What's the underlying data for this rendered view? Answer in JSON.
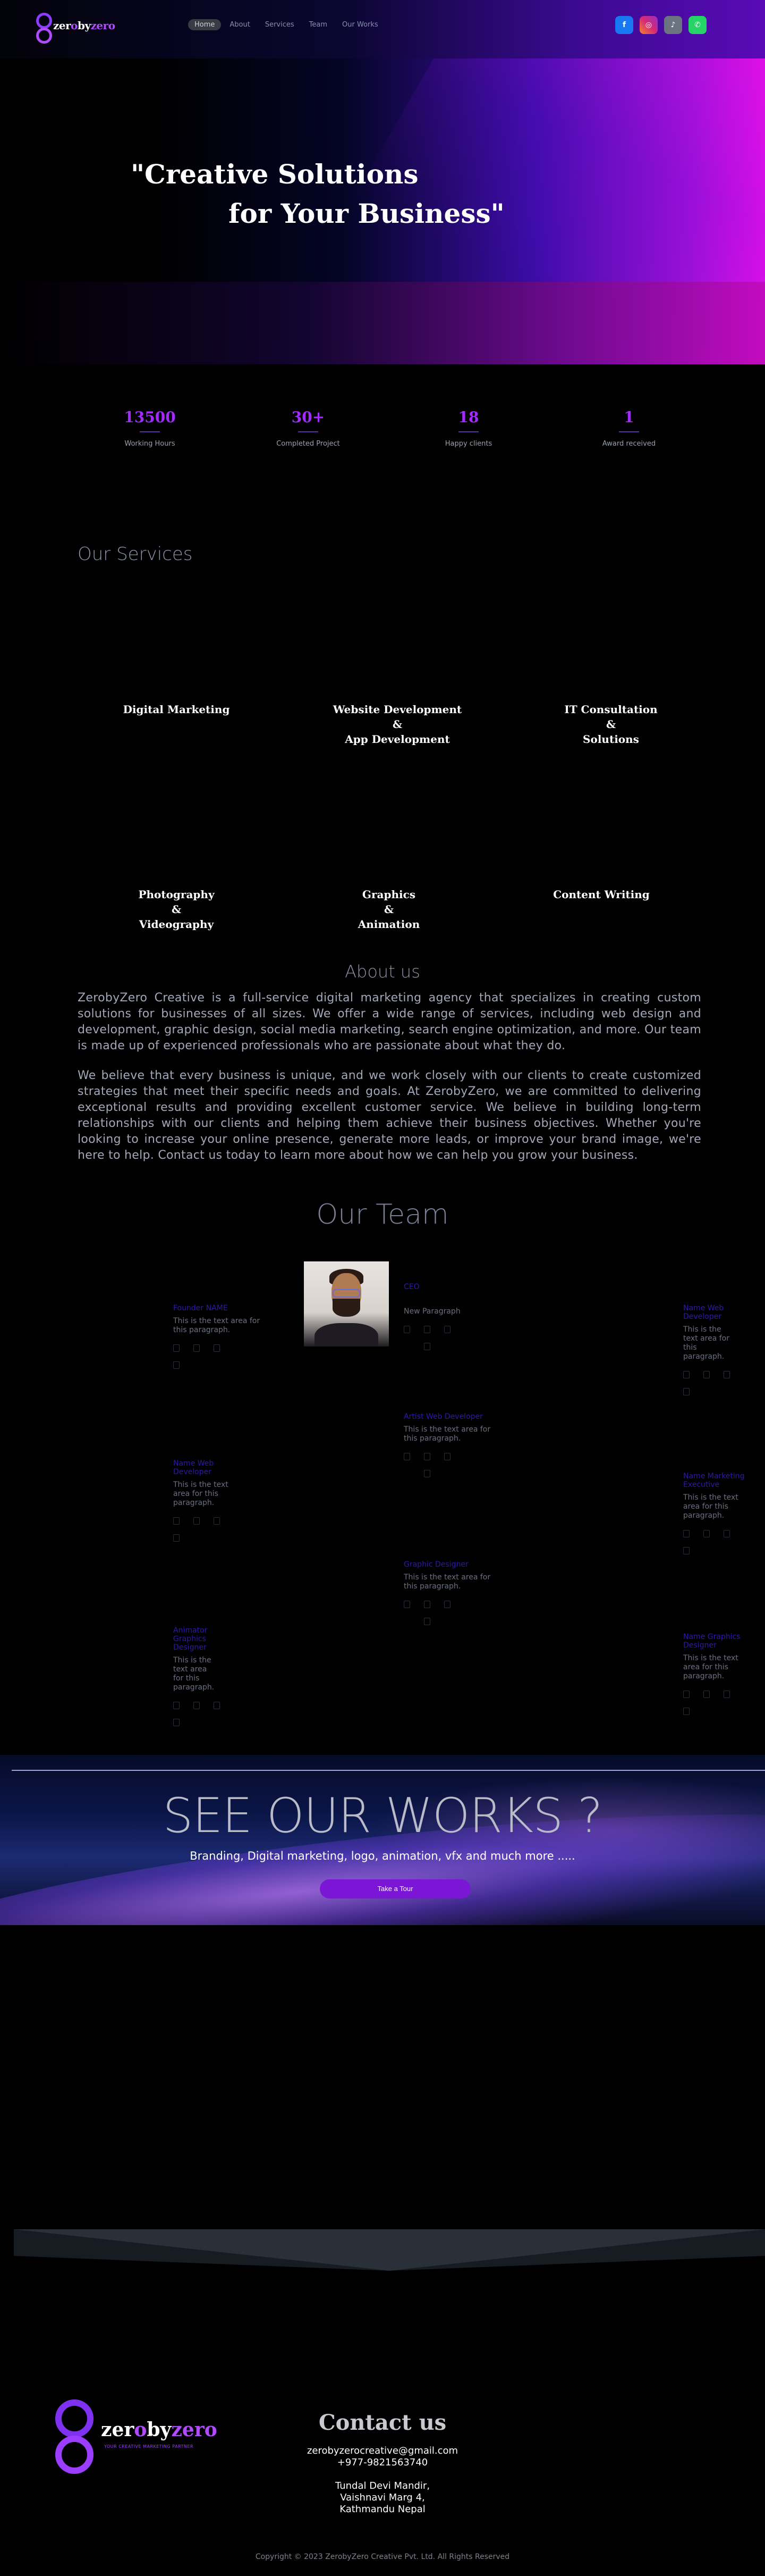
{
  "brand": {
    "logo_word_white": "zer",
    "logo_word_white2": "by",
    "logo_word_purple": "zero",
    "footer_tagline": "YOUR CREATIVE MARKETING PARTNER"
  },
  "nav": {
    "items": [
      "Home",
      "About",
      "Services",
      "Team",
      "Our Works"
    ],
    "active": "Home"
  },
  "social": [
    {
      "icon": "facebook-icon",
      "glyph": "f",
      "color": "#1877f2"
    },
    {
      "icon": "instagram-icon",
      "glyph": "◎",
      "color": "#d62976"
    },
    {
      "icon": "tiktok-icon",
      "glyph": "♪",
      "color": "#6b7280"
    },
    {
      "icon": "whatsapp-icon",
      "glyph": "✆",
      "color": "#25d366"
    }
  ],
  "hero": {
    "line1": "\"Creative Solutions",
    "line2": "for Your Business\""
  },
  "stats": [
    {
      "value": "13500",
      "label": "Working Hours"
    },
    {
      "value": "30+",
      "label": "Completed Project"
    },
    {
      "value": "18",
      "label": "Happy clients"
    },
    {
      "value": "1",
      "label": "Award received"
    }
  ],
  "services": {
    "title": "Our Services",
    "items": [
      [
        "Digital Marketing"
      ],
      [
        "Website Development",
        "&",
        "App Development"
      ],
      [
        "IT Consultation",
        "&",
        "Solutions"
      ],
      [
        "Photography",
        "&",
        "Videography"
      ],
      [
        "Graphics",
        "&",
        "Animation"
      ],
      [
        "Content Writing"
      ]
    ]
  },
  "about": {
    "title": "About us",
    "p1": "ZerobyZero Creative is a full-service digital marketing agency that specializes in creating custom solutions for businesses of all sizes. We offer a wide range of services, including web design and development, graphic design, social media marketing, search engine optimization, and more. Our team is made up of experienced professionals who are passionate about what they do.",
    "p2": "We believe that every business is unique, and we work closely with our clients to create customized strategies that meet their specific needs and goals. At ZerobyZero, we are committed to delivering exceptional results and providing excellent customer service. We believe in building long-term relationships with our clients and helping them achieve their business objectives. Whether you're looking to increase your online presence, generate more leads, or improve your brand image, we're here to help. Contact us today to learn more about how we can help you grow your business."
  },
  "team": {
    "title": "Our Team",
    "members": [
      {
        "name": "Founder NAME",
        "text": "This is the text area for this paragraph."
      },
      {
        "name": "CEO",
        "text": "New Paragraph"
      },
      {
        "name": "Name Web Developer",
        "text": "This is the text area for this paragraph."
      },
      {
        "name": "Artist Web Developer",
        "text": "This is the text area for this paragraph."
      },
      {
        "name": "Name Web Developer",
        "text": "This is the text area for this paragraph."
      },
      {
        "name": "Name Marketing Executive",
        "text": "This is the text area for this paragraph."
      },
      {
        "name": "Graphic Designer",
        "text": "This is the text area for this paragraph."
      },
      {
        "name": "Animator Graphics Designer",
        "text": "This is the text area for this paragraph."
      },
      {
        "name": "Name Graphics Designer",
        "text": "This is the text area for this paragraph."
      }
    ]
  },
  "works": {
    "title": "SEE OUR WORKS ?",
    "subtitle": "Branding, Digital marketing, logo, animation, vfx and much more .....",
    "button": "Take a Tour"
  },
  "contact": {
    "title": "Contact us",
    "email": "zerobyzerocreative@gmail.com",
    "phone": "+977-9821563740",
    "address1": "Tundal Devi Mandir,",
    "address2": "Vaishnavi Marg 4,",
    "address3": "Kathmandu Nepal"
  },
  "copyright": "Copyright © 2023 ZerobyZero Creative Pvt. Ltd. All Rights Reserved"
}
